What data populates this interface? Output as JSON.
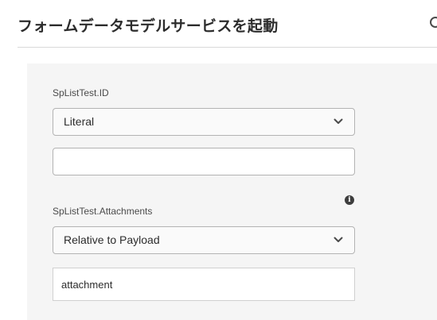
{
  "header": {
    "title": "フォームデータモデルサービスを起動"
  },
  "fields": [
    {
      "label": "SpListTest.ID",
      "mode": "Literal",
      "value": ""
    },
    {
      "label": "SpListTest.Attachments",
      "mode": "Relative to Payload",
      "value": "attachment",
      "info_icon": "i"
    }
  ],
  "icons": {
    "header_right": "circle-icon",
    "dropdown": "chevron-down-icon",
    "info": "info-icon"
  },
  "colors": {
    "text": "#2c2c2c",
    "panel_bg": "#f5f5f5",
    "border": "#b3b3b3"
  }
}
